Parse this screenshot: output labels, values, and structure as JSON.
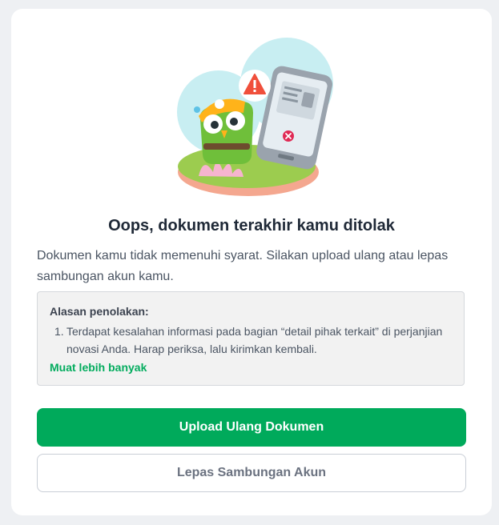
{
  "dialog": {
    "title": "Oops, dokumen terakhir kamu ditolak",
    "description": "Dokumen kamu tidak memenuhi syarat. Silakan upload ulang atau lepas sambungan akun kamu."
  },
  "reason": {
    "heading": "Alasan penolakan:",
    "items": [
      {
        "number": "1.",
        "text": "Terdapat kesalahan informasi pada bagian “detail pihak terkait” di perjanjian novasi Anda. Harap periksa, lalu kirimkan kembali."
      }
    ],
    "more_label": "Muat lebih banyak"
  },
  "actions": {
    "primary_label": "Upload Ulang Dokumen",
    "secondary_label": "Lepas Sambungan Akun"
  },
  "colors": {
    "brand_green": "#00aa5b",
    "link_green": "#03ac5e",
    "error_red": "#e02954"
  },
  "illustration": {
    "icons": [
      "owl-mascot-icon",
      "warning-triangle-icon",
      "phone-document-icon",
      "rejected-x-icon"
    ]
  }
}
